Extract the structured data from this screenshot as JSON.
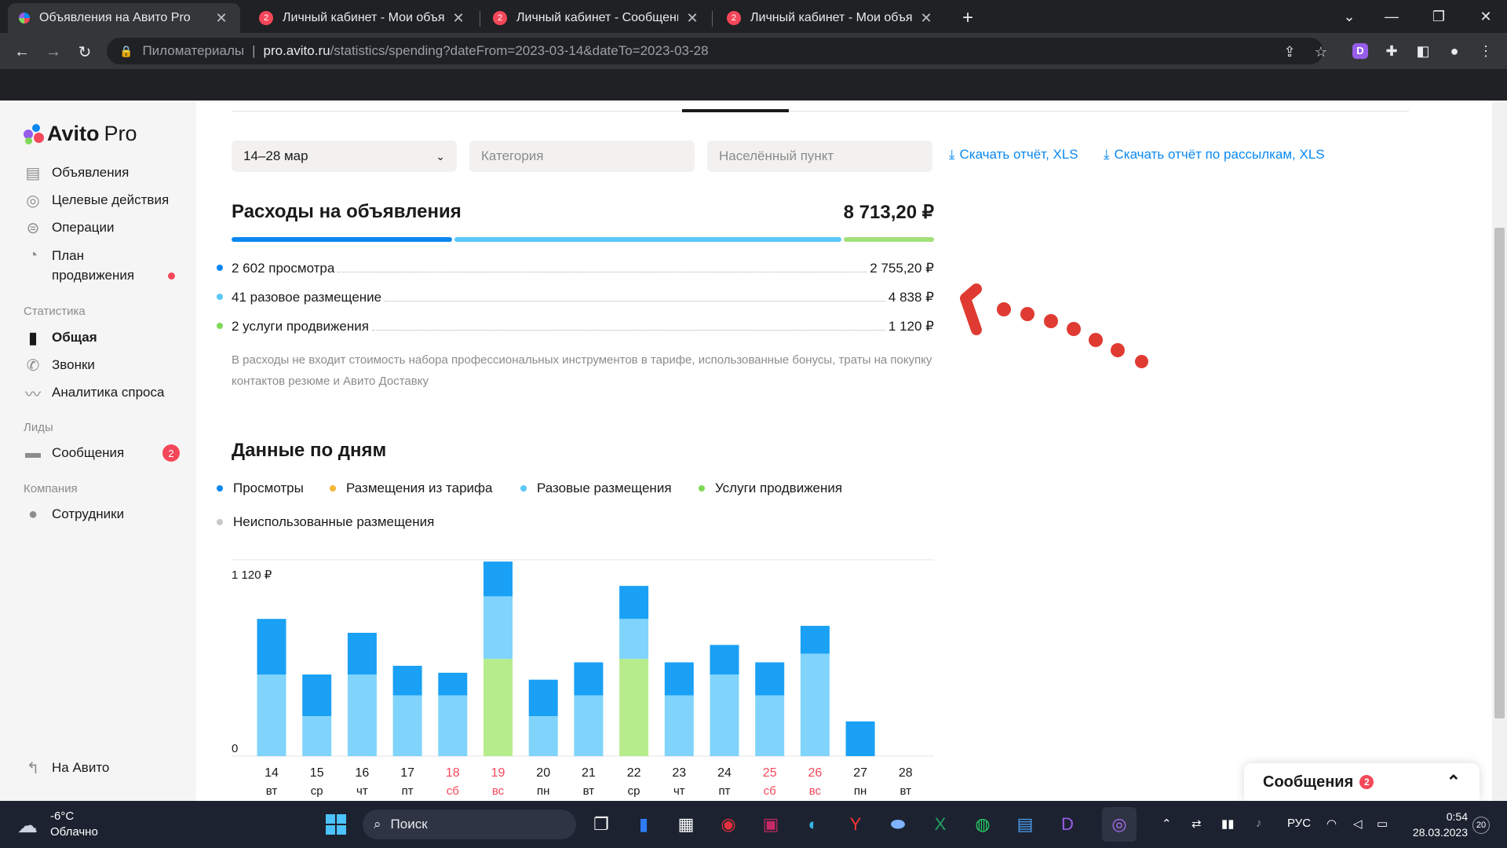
{
  "browser": {
    "tabs": [
      {
        "title": "Объявления на Авито Pro",
        "active": true,
        "badge": ""
      },
      {
        "title": "Личный кабинет - Мои объявле",
        "active": false,
        "badge": "2"
      },
      {
        "title": "Личный кабинет - Сообщения",
        "active": false,
        "badge": "2"
      },
      {
        "title": "Личный кабинет - Мои объявле",
        "active": false,
        "badge": "2"
      }
    ],
    "new_tab": "+",
    "address": {
      "site": "Пиломатериалы",
      "domain": "pro.avito.ru",
      "path": "/statistics/spending?dateFrom=2023-03-14&dateTo=2023-03-28"
    }
  },
  "sidebar": {
    "logo": {
      "brand": "Avito",
      "suffix": "Pro"
    },
    "items": [
      {
        "label": "Объявления",
        "icon": "list-icon"
      },
      {
        "label": "Целевые действия",
        "icon": "target-icon"
      },
      {
        "label": "Операции",
        "icon": "ruble-icon"
      },
      {
        "label": "План продвижения",
        "icon": "plan-icon"
      }
    ],
    "stats_header": "Статистика",
    "stats_items": [
      {
        "label": "Общая",
        "icon": "bar-chart-icon"
      },
      {
        "label": "Звонки",
        "icon": "phone-icon"
      },
      {
        "label": "Аналитика спроса",
        "icon": "trend-icon"
      }
    ],
    "leads_header": "Лиды",
    "messages": {
      "label": "Сообщения",
      "badge": "2"
    },
    "company_header": "Компания",
    "staff": {
      "label": "Сотрудники"
    },
    "back": {
      "label": "На Авито"
    }
  },
  "filters": {
    "period": "14–28 мар",
    "category_placeholder": "Категория",
    "city_placeholder": "Населённый пункт",
    "download_report": "Скачать отчёт, XLS",
    "download_mailing": "Скачать отчёт по рассылкам, XLS"
  },
  "spending": {
    "title": "Расходы на объявления",
    "total": "8 713,20 ₽",
    "rows": [
      {
        "label": "2 602 просмотра",
        "value": "2 755,20 ₽",
        "color": "#0a88f0"
      },
      {
        "label": "41 разовое размещение",
        "value": "4 838 ₽",
        "color": "#5ac8fa"
      },
      {
        "label": "2 услуги продвижения",
        "value": "1 120 ₽",
        "color": "#7ed957"
      }
    ],
    "note": "В расходы не входит стоимость набора профессиональных инструментов в тарифе, использованные бонусы, траты на покупку контактов резюме и Авито Доставку"
  },
  "daily": {
    "title": "Данные по дням",
    "legend": [
      {
        "label": "Просмотры",
        "color": "#0a88f0"
      },
      {
        "label": "Размещения из тарифа",
        "color": "#f5b63a"
      },
      {
        "label": "Разовые размещения",
        "color": "#5ac8fa"
      },
      {
        "label": "Услуги продвижения",
        "color": "#7ed957"
      },
      {
        "label": "Неиспользованные размещения",
        "color": "#c8c8c8"
      }
    ]
  },
  "chart_data": {
    "type": "bar",
    "stacked": true,
    "ytick_labels": [
      "1 120 ₽",
      "0"
    ],
    "ylim": [
      0,
      1130
    ],
    "categories": [
      "14",
      "15",
      "16",
      "17",
      "18",
      "19",
      "20",
      "21",
      "22",
      "23",
      "24",
      "25",
      "26",
      "27",
      "28"
    ],
    "weekdays": [
      "вт",
      "ср",
      "чт",
      "пт",
      "сб",
      "вс",
      "пн",
      "вт",
      "ср",
      "чт",
      "пт",
      "сб",
      "вс",
      "пн",
      "вт"
    ],
    "weekend": [
      false,
      false,
      false,
      false,
      true,
      true,
      false,
      false,
      false,
      false,
      false,
      true,
      true,
      false,
      false
    ],
    "series": [
      {
        "name": "Услуги продвижения",
        "color": "#b7ec8c",
        "values": [
          0,
          0,
          0,
          0,
          0,
          560,
          0,
          0,
          560,
          0,
          0,
          0,
          0,
          0,
          0
        ]
      },
      {
        "name": "Разовые размещения",
        "color": "#80d4fb",
        "values": [
          470,
          230,
          470,
          350,
          350,
          360,
          230,
          350,
          230,
          350,
          470,
          350,
          590,
          0,
          0
        ]
      },
      {
        "name": "Просмотры",
        "color": "#1aa0f5",
        "values": [
          320,
          240,
          240,
          170,
          130,
          200,
          210,
          190,
          190,
          190,
          170,
          190,
          160,
          200,
          0
        ]
      }
    ]
  },
  "messages_widget": {
    "label": "Сообщения",
    "badge": "2"
  },
  "taskbar": {
    "weather_temp": "-6°C",
    "weather_text": "Облачно",
    "search_label": "Поиск",
    "lang": "РУС",
    "time": "0:54",
    "date": "28.03.2023",
    "notif": "20"
  }
}
